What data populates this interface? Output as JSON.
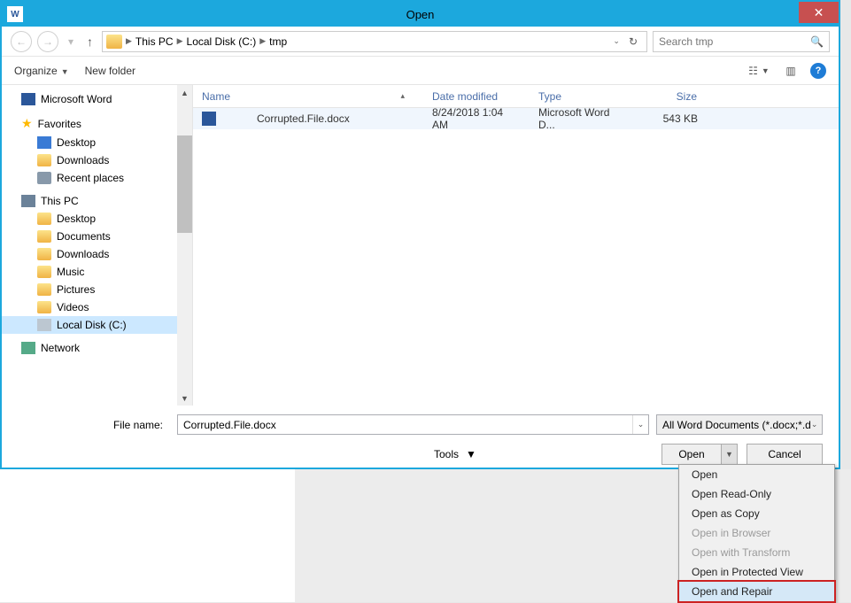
{
  "titlebar": {
    "title": "Open"
  },
  "breadcrumb": {
    "seg1": "This PC",
    "seg2": "Local Disk (C:)",
    "seg3": "tmp"
  },
  "search": {
    "placeholder": "Search tmp"
  },
  "toolbar": {
    "organize": "Organize",
    "newfolder": "New folder"
  },
  "tree": {
    "word": "Microsoft Word",
    "fav": "Favorites",
    "desktop": "Desktop",
    "downloads": "Downloads",
    "recent": "Recent places",
    "thispc": "This PC",
    "pc_desktop": "Desktop",
    "pc_documents": "Documents",
    "pc_downloads": "Downloads",
    "pc_music": "Music",
    "pc_pictures": "Pictures",
    "pc_videos": "Videos",
    "pc_disk": "Local Disk (C:)",
    "network": "Network"
  },
  "columns": {
    "name": "Name",
    "date": "Date modified",
    "type": "Type",
    "size": "Size"
  },
  "file": {
    "name": "Corrupted.File.docx",
    "date": "8/24/2018 1:04 AM",
    "type": "Microsoft Word D...",
    "size": "543 KB"
  },
  "filename": {
    "label": "File name:",
    "value": "Corrupted.File.docx"
  },
  "filter": {
    "label": "All Word Documents (*.docx;*.d"
  },
  "buttons": {
    "tools": "Tools",
    "open": "Open",
    "cancel": "Cancel"
  },
  "menu": {
    "open": "Open",
    "readonly": "Open Read-Only",
    "copy": "Open as Copy",
    "browser": "Open in Browser",
    "transform": "Open with Transform",
    "protected": "Open in Protected View",
    "repair": "Open and Repair"
  }
}
